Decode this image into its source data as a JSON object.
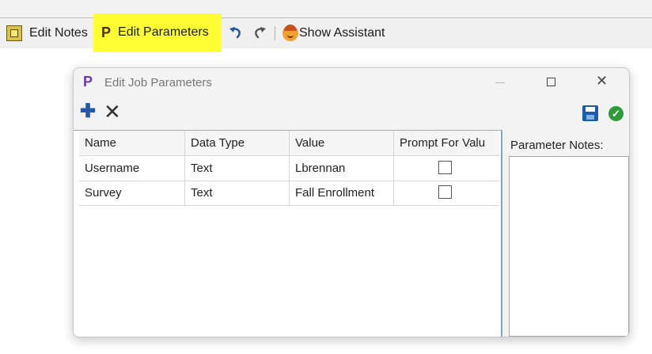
{
  "toolbar": {
    "edit_notes_label": "Edit Notes",
    "edit_params_label": "Edit Parameters",
    "edit_params_icon_letter": "P",
    "show_assistant_label": "Show Assistant",
    "highlight_color": "#ffff33"
  },
  "dialog": {
    "icon_letter": "P",
    "title": "Edit Job Parameters",
    "columns": [
      "Name",
      "Data Type",
      "Value",
      "Prompt For Valu"
    ],
    "rows": [
      {
        "name": "Username",
        "data_type": "Text",
        "value": "Lbrennan",
        "prompt": false
      },
      {
        "name": "Survey",
        "data_type": "Text",
        "value": "Fall Enrollment",
        "prompt": false
      }
    ],
    "notes_label": "Parameter Notes:",
    "notes_value": ""
  },
  "icons": [
    "notes-icon",
    "p-icon",
    "undo-icon",
    "redo-icon",
    "assistant-icon",
    "plus-icon",
    "delete-x-icon",
    "save-icon",
    "check-icon",
    "minimize-icon",
    "maximize-icon",
    "close-icon"
  ],
  "colors": {
    "accent_blue": "#2458a6",
    "save_blue": "#1a5ca8",
    "ok_green": "#2e9a3a",
    "title_p_purple": "#6b3aa8"
  }
}
